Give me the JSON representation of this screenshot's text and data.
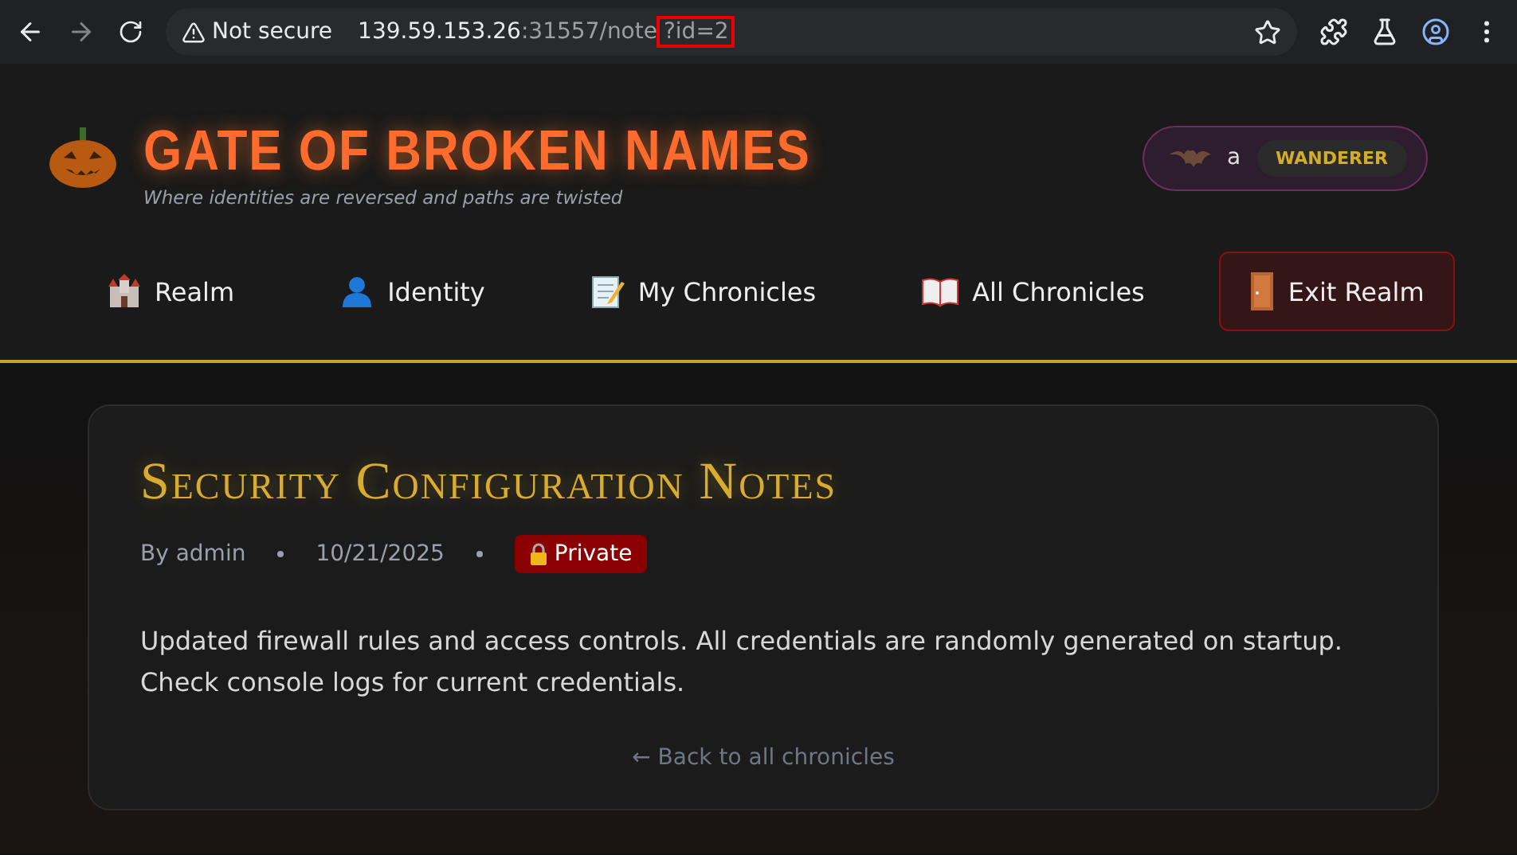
{
  "browser": {
    "security": "Not secure",
    "url_host": "139.59.153.26",
    "url_path": ":31557/note",
    "url_query": "?id=2"
  },
  "header": {
    "title": "GATE OF BROKEN NAMES",
    "tagline": "Where identities are reversed and paths are twisted",
    "user": {
      "name": "a",
      "role": "WANDERER"
    }
  },
  "nav": [
    {
      "label": "Realm",
      "kind": "link"
    },
    {
      "label": "Identity",
      "kind": "link"
    },
    {
      "label": "My Chronicles",
      "kind": "link"
    },
    {
      "label": "All Chronicles",
      "kind": "link"
    },
    {
      "label": "Exit Realm",
      "kind": "danger"
    }
  ],
  "note": {
    "title": "Security Configuration Notes",
    "author": "By admin",
    "date": "10/21/2025",
    "badge": "Private",
    "body": "Updated firewall rules and access controls. All credentials are randomly generated on startup. Check console logs for current credentials.",
    "back_link": "← Back to all chronicles"
  }
}
